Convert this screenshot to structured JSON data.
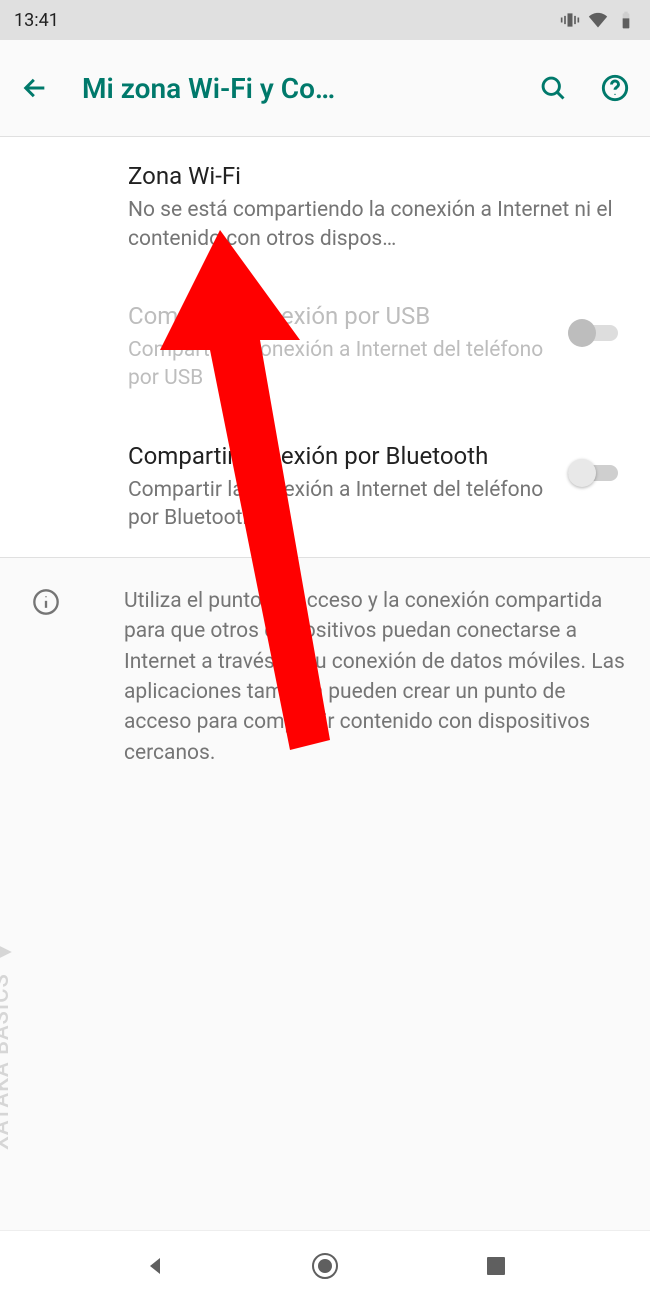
{
  "status": {
    "time": "13:41"
  },
  "header": {
    "title": "Mi zona Wi-Fi y Co…"
  },
  "settings": {
    "wifi_zone": {
      "title": "Zona Wi-Fi",
      "sub": "No se está compartiendo la conexión a Internet ni el contenido con otros dispos…"
    },
    "usb": {
      "title": "Compartir conexión por USB",
      "sub": "Compartir la conexión a Internet del teléfono por USB"
    },
    "bluetooth": {
      "title": "Compartir conexión por Bluetooth",
      "sub": "Compartir la conexión a Internet del teléfono por Bluetooth"
    }
  },
  "info": {
    "text": "Utiliza el punto de acceso y la conexión compartida para que otros dispositivos puedan conectarse a Internet a través de tu conexión de datos móviles. Las aplicaciones también pueden crear un punto de acceso para compartir contenido con dispositivos cercanos."
  },
  "watermark": "XATAKA BASICS"
}
